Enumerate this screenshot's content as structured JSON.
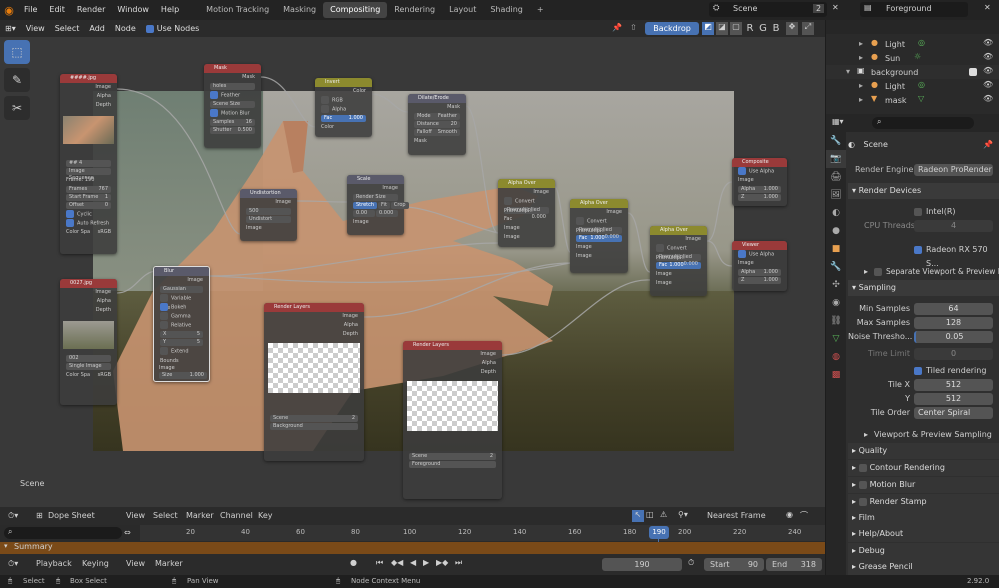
{
  "topbar": {
    "menus": [
      "File",
      "Edit",
      "Render",
      "Window",
      "Help"
    ],
    "workspaces": [
      "Motion Tracking",
      "Masking",
      "Compositing",
      "Rendering",
      "Layout",
      "Shading"
    ],
    "active_workspace": "Compositing",
    "scene_name": "Scene",
    "scene_count": "2",
    "view_layer": "Foreground"
  },
  "node_header": {
    "menus": [
      "View",
      "Select",
      "Add",
      "Node"
    ],
    "use_nodes_label": "Use Nodes",
    "backdrop_label": "Backdrop",
    "channels": [
      "R",
      "G",
      "B"
    ]
  },
  "viewport": {
    "scene_label": "Scene"
  },
  "nodes": {
    "image1": {
      "title": "####.jpg",
      "outputs": [
        "Image",
        "Alpha",
        "Depth"
      ],
      "name": "##",
      "count": "4",
      "source": "Image Sequence",
      "frames_label": "Frames",
      "frames": "767",
      "start_label": "Start Frame",
      "start": "1",
      "offset_label": "Offset",
      "offset": "0",
      "cyclic": "Cyclic",
      "auto_refresh": "Auto Refresh",
      "colorspace_label": "Color Spa",
      "colorspace": "sRGB",
      "frame_label": "Frame: 190"
    },
    "image2": {
      "title": "0027.jpg",
      "outputs": [
        "Image",
        "Alpha",
        "Depth"
      ],
      "name": "002",
      "source": "Single Image",
      "colorspace_label": "Color Spa",
      "colorspace": "sRGB"
    },
    "mask": {
      "title": "Mask",
      "output": "Mask",
      "name": "holes",
      "feather": "Feather",
      "size": "Scene Size",
      "motion_blur": "Motion Blur",
      "samples_label": "Samples",
      "samples": "16",
      "shutter_label": "Shutter",
      "shutter": "0.500"
    },
    "invert": {
      "title": "Invert",
      "output": "Color",
      "rgb": "RGB",
      "alpha": "Alpha",
      "fac_label": "Fac",
      "fac": "1.000",
      "input": "Color"
    },
    "dilate": {
      "title": "Dilate/Erode",
      "output": "Mask",
      "mode_label": "Mode",
      "mode": "Feather",
      "distance_label": "Distance",
      "distance": "20",
      "falloff_label": "Falloff",
      "falloff": "Smooth",
      "input": "Mask"
    },
    "undistort": {
      "title": "Undistortion",
      "output": "Image",
      "clip": "500",
      "method": "Undistort",
      "input": "Image"
    },
    "scale": {
      "title": "Scale",
      "output": "Image",
      "space": "Render Size",
      "modes": [
        "Stretch",
        "Fit",
        "Crop"
      ],
      "x": "0.00",
      "y": "0.000",
      "input": "Image"
    },
    "blur": {
      "title": "Blur",
      "output": "Image",
      "type": "Gaussian",
      "variable": "Variable Size",
      "bokeh": "Bokeh",
      "gamma": "Gamma",
      "relative": "Relative",
      "x_label": "X",
      "x": "5",
      "y_label": "Y",
      "y": "5",
      "extend": "Extend Bounds",
      "input": "Image",
      "size_label": "Size",
      "size": "1.000"
    },
    "alphaover1": {
      "title": "Alpha Over",
      "output": "Image",
      "convert": "Convert Premultip...",
      "premult_label": "Premultiplied",
      "premult": "0.000",
      "fac_label": "Fac",
      "fac": "1.000",
      "inputs": [
        "Image",
        "Image"
      ]
    },
    "alphaover2": {
      "title": "Alpha Over",
      "output": "Image",
      "convert": "Convert Premultip...",
      "premult_label": "Premultiplied",
      "premult": "0.000",
      "fac_label": "Fac",
      "fac": "1.000",
      "inputs": [
        "Image",
        "Image"
      ]
    },
    "alphaover3": {
      "title": "Alpha Over",
      "output": "Image",
      "convert": "Convert Premultip...",
      "premult_label": "Premultiplied",
      "premult": "0.000",
      "fac_label": "Fac",
      "fac": "1.000",
      "inputs": [
        "Image",
        "Image"
      ]
    },
    "composite": {
      "title": "Composite",
      "use_alpha": "Use Alpha",
      "inputs": [
        "Image",
        "Alpha",
        "Z"
      ],
      "alpha": "1.000",
      "z": "1.000"
    },
    "viewer": {
      "title": "Viewer",
      "use_alpha": "Use Alpha",
      "inputs": [
        "Image",
        "Alpha",
        "Z"
      ],
      "alpha": "1.000",
      "z": "1.000"
    },
    "renderlayers1": {
      "title": "Render Layers",
      "outputs": [
        "Image",
        "Alpha",
        "Depth"
      ],
      "scene": "Scene",
      "layer": "Background",
      "count": "2"
    },
    "renderlayers2": {
      "title": "Render Layers",
      "outputs": [
        "Image",
        "Alpha",
        "Depth"
      ],
      "scene": "Scene",
      "layer": "Foreground",
      "count": "2"
    }
  },
  "outliner": {
    "items": [
      {
        "label": "Light",
        "indent": 2
      },
      {
        "label": "Sun",
        "indent": 2
      },
      {
        "label": "background",
        "indent": 1
      },
      {
        "label": "Light",
        "indent": 2
      },
      {
        "label": "mask",
        "indent": 2
      }
    ]
  },
  "properties": {
    "scene_title": "Scene",
    "render_engine_label": "Render Engine",
    "render_engine": "Radeon ProRender",
    "render_devices": "Render Devices",
    "cpu_label": "Intel(R) Core(TM)...",
    "cpu_threads_label": "CPU Threads",
    "cpu_threads": "4",
    "gpu_label": "Radeon RX 570 S...",
    "separate_viewport": "Separate Viewport & Preview De",
    "sampling": "Sampling",
    "min_samples_label": "Min Samples",
    "min_samples": "64",
    "max_samples_label": "Max Samples",
    "max_samples": "128",
    "noise_label": "Noise Thresho...",
    "noise": "0.05",
    "time_limit_label": "Time Limit",
    "time_limit": "0",
    "tiled": "Tiled rendering",
    "tile_x_label": "Tile X",
    "tile_x": "512",
    "tile_y_label": "Y",
    "tile_y": "512",
    "tile_order_label": "Tile Order",
    "tile_order": "Center Spiral",
    "viewport_sampling": "Viewport & Preview Sampling",
    "sections": [
      "Quality",
      "Contour Rendering",
      "Motion Blur",
      "Render Stamp",
      "Film",
      "Help/About",
      "Debug",
      "Grease Pencil"
    ]
  },
  "timeline": {
    "editor": "Dope Sheet",
    "menus": [
      "View",
      "Select",
      "Marker",
      "Channel",
      "Key"
    ],
    "snap": "Nearest Frame",
    "ticks": [
      "20",
      "40",
      "60",
      "80",
      "100",
      "120",
      "140",
      "160",
      "180",
      "200",
      "220",
      "240"
    ],
    "current_frame": "190",
    "summary": "Summary",
    "playback": "Playback",
    "keying": "Keying",
    "view": "View",
    "marker": "Marker",
    "frame_field": "190",
    "start_label": "Start",
    "start": "90",
    "end_label": "End",
    "end": "318"
  },
  "status": {
    "select": "Select",
    "box_select": "Box Select",
    "pan": "Pan View",
    "context": "Node Context Menu",
    "version": "2.92.0"
  }
}
